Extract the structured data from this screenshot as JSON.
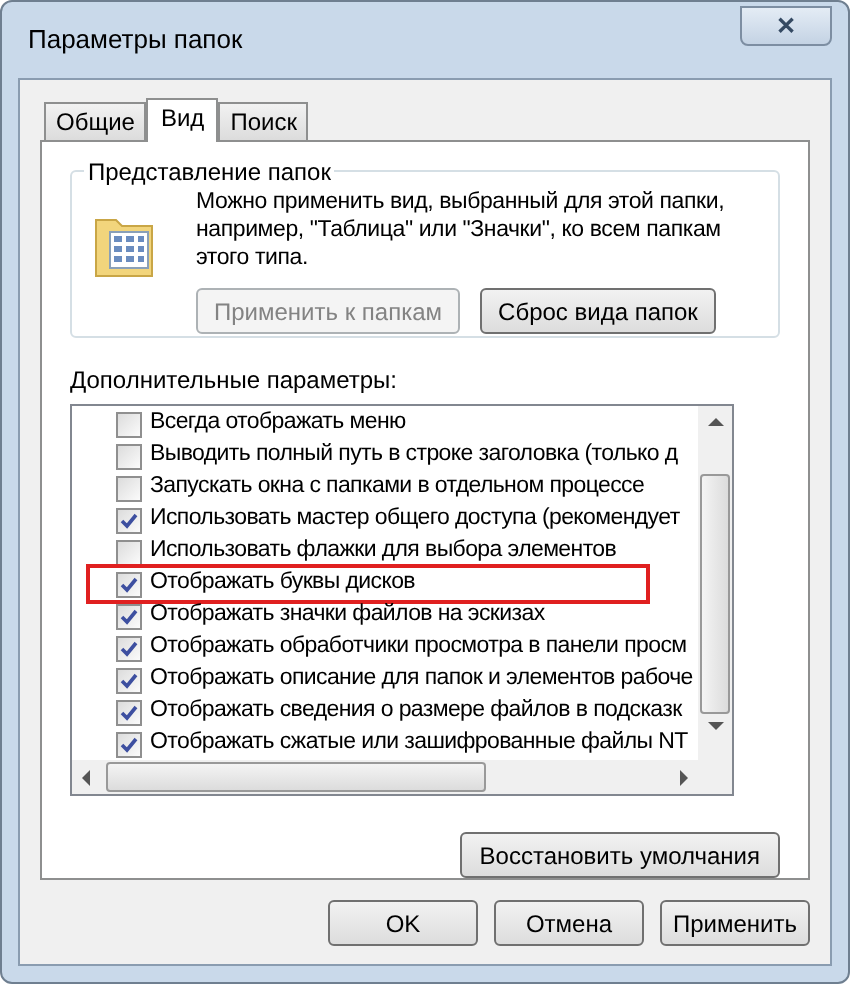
{
  "window": {
    "title": "Параметры папок",
    "close": "✕"
  },
  "tabs": [
    {
      "label": "Общие",
      "selected": false
    },
    {
      "label": "Вид",
      "selected": true
    },
    {
      "label": "Поиск",
      "selected": false
    }
  ],
  "folder_views": {
    "title": "Представление папок",
    "description": "Можно применить вид, выбранный для этой папки, например, \"Таблица\" или \"Значки\", ко всем папкам этого типа.",
    "buttons": [
      {
        "label": "Применить к папкам",
        "disabled": true
      },
      {
        "label": "Сброс вида папок",
        "disabled": false
      }
    ]
  },
  "advanced": {
    "title": "Дополнительные параметры:",
    "items": [
      {
        "label": "Всегда отображать меню",
        "checked": false,
        "highlighted": false
      },
      {
        "label": "Выводить полный путь в строке заголовка (только д",
        "checked": false,
        "highlighted": false
      },
      {
        "label": "Запускать окна с папками в отдельном процессе",
        "checked": false,
        "highlighted": false
      },
      {
        "label": "Использовать мастер общего доступа (рекомендует",
        "checked": true,
        "highlighted": false
      },
      {
        "label": "Использовать флажки для выбора элементов",
        "checked": false,
        "highlighted": false
      },
      {
        "label": "Отображать буквы дисков",
        "checked": true,
        "highlighted": true
      },
      {
        "label": "Отображать значки файлов на эскизах",
        "checked": true,
        "highlighted": false
      },
      {
        "label": "Отображать обработчики просмотра в панели просм",
        "checked": true,
        "highlighted": false
      },
      {
        "label": "Отображать описание для папок и элементов рабоче",
        "checked": true,
        "highlighted": false
      },
      {
        "label": "Отображать сведения о размере файлов в подсказк",
        "checked": true,
        "highlighted": false
      },
      {
        "label": "Отображать сжатые или зашифрованные файлы NT",
        "checked": true,
        "highlighted": false
      }
    ]
  },
  "restore_button": "Восстановить умолчания",
  "buttons": [
    {
      "label": "OK"
    },
    {
      "label": "Отмена"
    },
    {
      "label": "Применить"
    }
  ]
}
